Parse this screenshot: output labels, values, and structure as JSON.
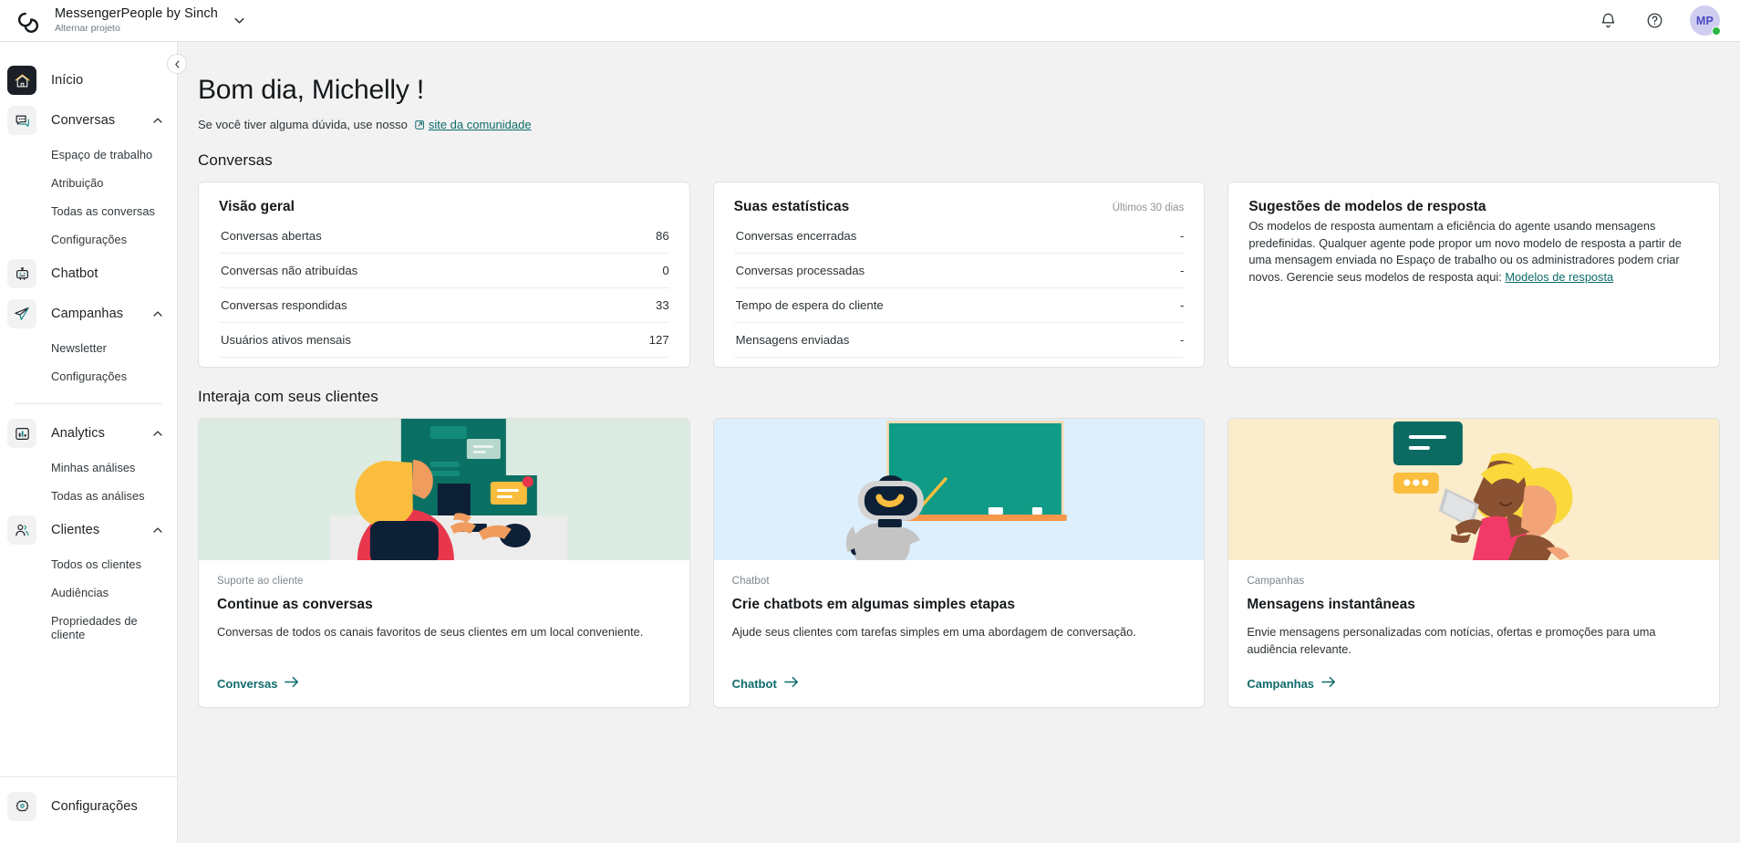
{
  "topbar": {
    "brand_title": "MessengerPeople by Sinch",
    "brand_subtitle": "Alternar projeto",
    "logo_icon": "sinch-loop-logo",
    "caret_icon": "chevron-down-icon",
    "notifications_icon": "bell-icon",
    "help_icon": "question-circle-icon",
    "avatar_initials": "MP",
    "status": "online"
  },
  "sidebar": {
    "collapse_icon": "chevron-left-icon",
    "items": [
      {
        "label": "Início",
        "icon": "home-icon",
        "active": true,
        "expandable": false,
        "children": []
      },
      {
        "label": "Conversas",
        "icon": "chat-bubbles-icon",
        "active": false,
        "expandable": true,
        "expanded": true,
        "children": [
          "Espaço de trabalho",
          "Atribuição",
          "Todas as conversas",
          "Configurações"
        ]
      },
      {
        "label": "Chatbot",
        "icon": "robot-icon",
        "active": false,
        "expandable": false,
        "children": []
      },
      {
        "label": "Campanhas",
        "icon": "paper-plane-icon",
        "active": false,
        "expandable": true,
        "expanded": true,
        "children": [
          "Newsletter",
          "Configurações"
        ]
      },
      {
        "label": "Analytics",
        "icon": "bar-chart-icon",
        "active": false,
        "expandable": true,
        "expanded": true,
        "children": [
          "Minhas análises",
          "Todas as análises"
        ]
      },
      {
        "label": "Clientes",
        "icon": "users-icon",
        "active": false,
        "expandable": true,
        "expanded": true,
        "children": [
          "Todos os clientes",
          "Audiências",
          "Propriedades de cliente"
        ]
      }
    ],
    "footer": {
      "label": "Configurações",
      "icon": "gear-icon"
    }
  },
  "main": {
    "greeting": "Bom dia, Michelly !",
    "subtitle_prefix": "Se você tiver alguma dúvida, use nosso",
    "community_link": "site da comunidade",
    "external_link_icon": "external-link-icon",
    "section_conversas": "Conversas",
    "section_interaja": "Interaja com seus clientes"
  },
  "overview_card": {
    "title": "Visão geral",
    "rows": [
      {
        "label": "Conversas abertas",
        "value": "86"
      },
      {
        "label": "Conversas não atribuídas",
        "value": "0"
      },
      {
        "label": "Conversas respondidas",
        "value": "33"
      },
      {
        "label": "Usuários ativos mensais",
        "value": "127"
      }
    ]
  },
  "stats_card": {
    "title": "Suas estatísticas",
    "period": "Últimos 30 dias",
    "rows": [
      {
        "label": "Conversas encerradas",
        "value": "-"
      },
      {
        "label": "Conversas processadas",
        "value": "-"
      },
      {
        "label": "Tempo de espera do cliente",
        "value": "-"
      },
      {
        "label": "Mensagens enviadas",
        "value": "-"
      }
    ]
  },
  "templates_card": {
    "title": "Sugestões de modelos de resposta",
    "body": "Os modelos de resposta aumentam a eficiência do agente usando mensagens predefinidas. Qualquer agente pode propor um novo modelo de resposta a partir de uma mensagem enviada no Espaço de trabalho ou os administradores podem criar novos. Gerencie seus modelos de resposta aqui: ",
    "link": "Modelos de resposta"
  },
  "promos": [
    {
      "kicker": "Suporte ao cliente",
      "title": "Continue as conversas",
      "desc": "Conversas de todos os canais favoritos de seus clientes em um local conveniente.",
      "link": "Conversas",
      "art": "agent-at-desk-illustration",
      "bg": "#dcebe1"
    },
    {
      "kicker": "Chatbot",
      "title": "Crie chatbots em algumas simples etapas",
      "desc": "Ajude seus clientes com tarefas simples em uma abordagem de conversação.",
      "link": "Chatbot",
      "art": "robot-at-blackboard-illustration",
      "bg": "#ddeffc"
    },
    {
      "kicker": "Campanhas",
      "title": "Mensagens instantâneas",
      "desc": "Envie mensagens personalizadas com notícias, ofertas e promoções para uma audiência relevante.",
      "link": "Campanhas",
      "art": "woman-with-phone-illustration",
      "bg": "#fbeccb"
    }
  ],
  "colors": {
    "accent_teal": "#0f6b6b",
    "page_bg": "#f2f2f2",
    "card_bg": "#ffffff",
    "status_green": "#2bb742",
    "avatar_bg": "#cfcdf0"
  }
}
